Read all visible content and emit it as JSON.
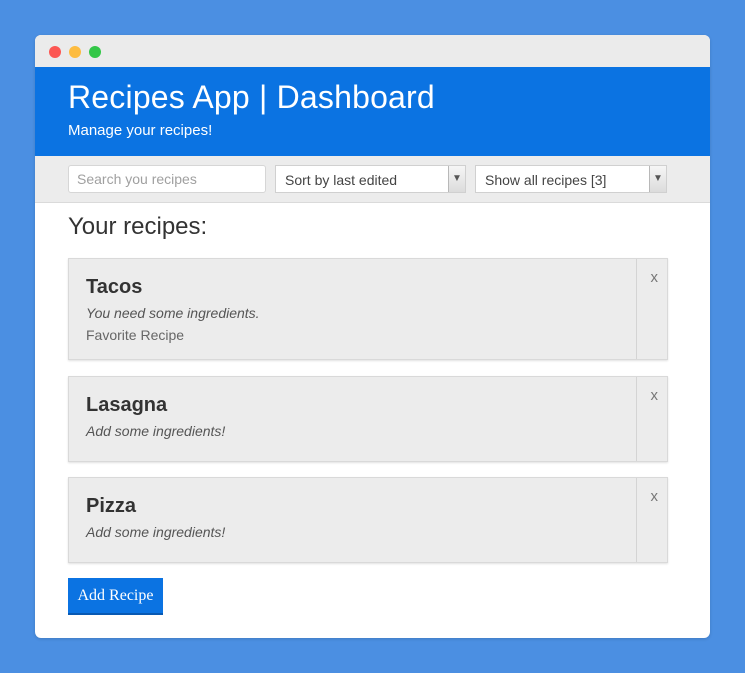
{
  "colors": {
    "background": "#4b8fe2",
    "header": "#0b73e2",
    "card": "#ececec",
    "button": "#0b73e2"
  },
  "window_controls": [
    "close",
    "minimize",
    "maximize"
  ],
  "header": {
    "title": "Recipes App | Dashboard",
    "subtitle": "Manage your recipes!"
  },
  "filters": {
    "search_placeholder": "Search you recipes",
    "search_value": "",
    "sort_value": "Sort by last edited",
    "show_value": "Show all recipes [3]"
  },
  "main": {
    "heading": "Your recipes:",
    "recipes": [
      {
        "title": "Tacos",
        "description": "You need some ingredients.",
        "tag": "Favorite Recipe",
        "remove_label": "x"
      },
      {
        "title": "Lasagna",
        "description": "Add some ingredients!",
        "tag": "",
        "remove_label": "x"
      },
      {
        "title": "Pizza",
        "description": "Add some ingredients!",
        "tag": "",
        "remove_label": "x"
      }
    ],
    "add_button": "Add Recipe"
  }
}
